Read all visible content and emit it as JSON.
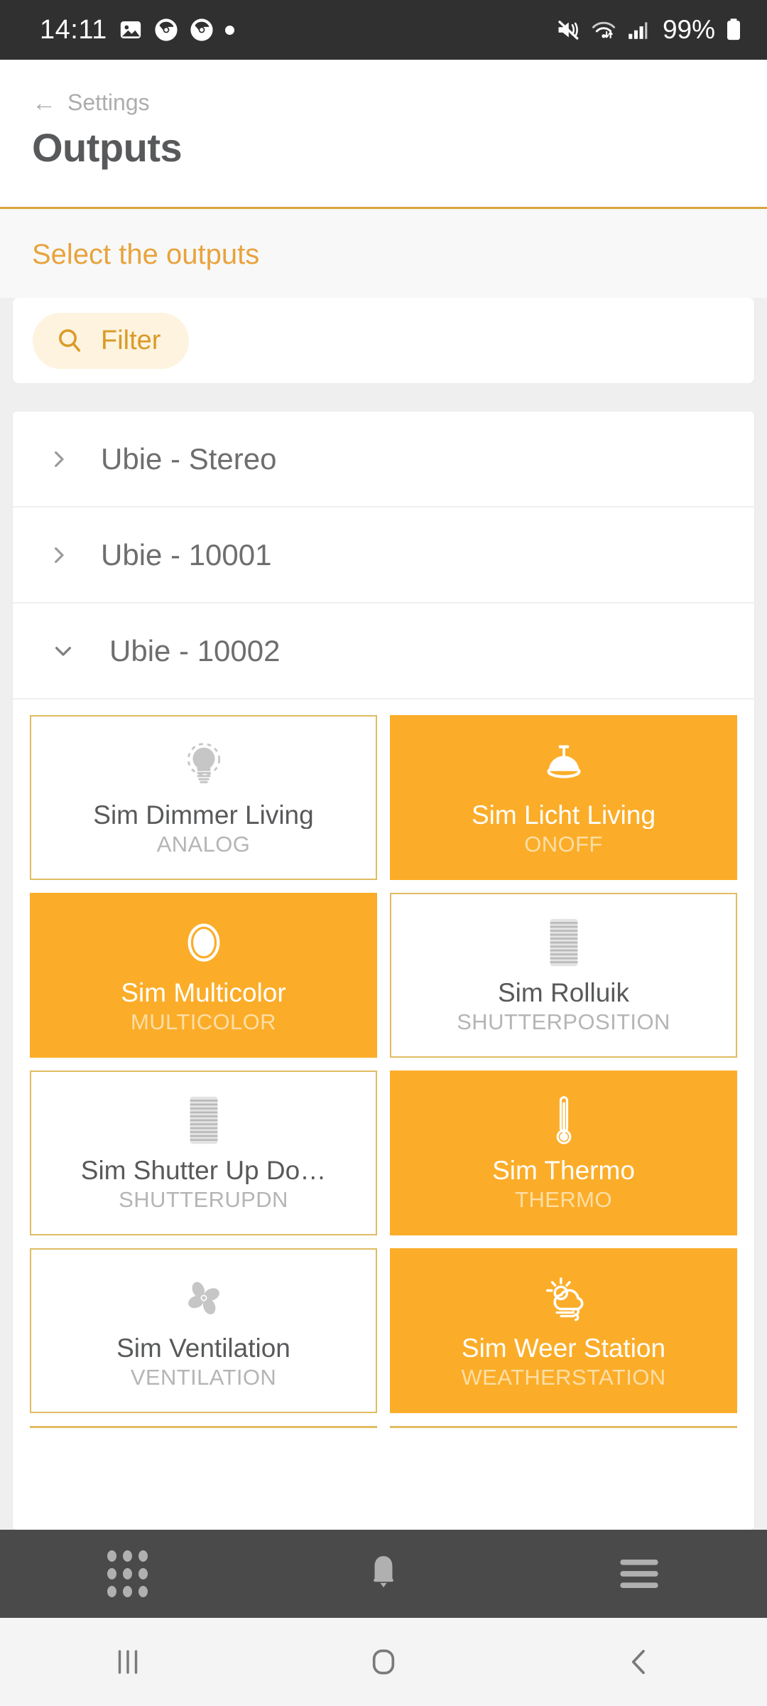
{
  "statusbar": {
    "time": "14:11",
    "battery_percent": "99%",
    "left_icons": [
      "image-icon",
      "chrome-icon",
      "chrome-icon",
      "dot-icon"
    ],
    "right_icons": [
      "mute-icon",
      "wifi-icon",
      "signal-icon",
      "battery-icon"
    ]
  },
  "header": {
    "back_label": "Settings",
    "title": "Outputs",
    "accent_color": "#D8A63C"
  },
  "main": {
    "section_title": "Select the outputs",
    "filter": {
      "label": "Filter",
      "icon": "search-icon"
    },
    "groups": [
      {
        "label": "Ubie - Stereo",
        "expanded": false,
        "chevron": "chevron-right-icon"
      },
      {
        "label": "Ubie - 10001",
        "expanded": false,
        "chevron": "chevron-right-icon"
      },
      {
        "label": "Ubie - 10002",
        "expanded": true,
        "chevron": "chevron-down-icon"
      }
    ],
    "tiles": [
      {
        "name": "Sim Dimmer Living",
        "type": "ANALOG",
        "state": "off",
        "icon": "lightbulb-icon"
      },
      {
        "name": "Sim Licht Living",
        "type": "ONOFF",
        "state": "on",
        "icon": "pendant-lamp-icon"
      },
      {
        "name": "Sim Multicolor",
        "type": "MULTICOLOR",
        "state": "on",
        "icon": "color-circle-icon"
      },
      {
        "name": "Sim Rolluik",
        "type": "SHUTTERPOSITION",
        "state": "off",
        "icon": "blind-icon"
      },
      {
        "name": "Sim Shutter Up Do…",
        "type": "SHUTTERUPDN",
        "state": "off",
        "icon": "blind-icon"
      },
      {
        "name": "Sim Thermo",
        "type": "THERMO",
        "state": "on",
        "icon": "thermometer-icon"
      },
      {
        "name": "Sim Ventilation",
        "type": "VENTILATION",
        "state": "off",
        "icon": "fan-icon"
      },
      {
        "name": "Sim Weer Station",
        "type": "WEATHERSTATION",
        "state": "on",
        "icon": "weather-icon"
      }
    ],
    "colors": {
      "tile_on": "#FBAD29",
      "tile_off_border": "#E0BC62",
      "accent": "#E8A33D"
    }
  },
  "appnav": {
    "items": [
      {
        "name": "apps-grid-icon"
      },
      {
        "name": "bell-icon"
      },
      {
        "name": "menu-icon"
      }
    ]
  },
  "sysnav": {
    "items": [
      {
        "name": "recents-icon"
      },
      {
        "name": "home-icon"
      },
      {
        "name": "back-icon"
      }
    ]
  }
}
